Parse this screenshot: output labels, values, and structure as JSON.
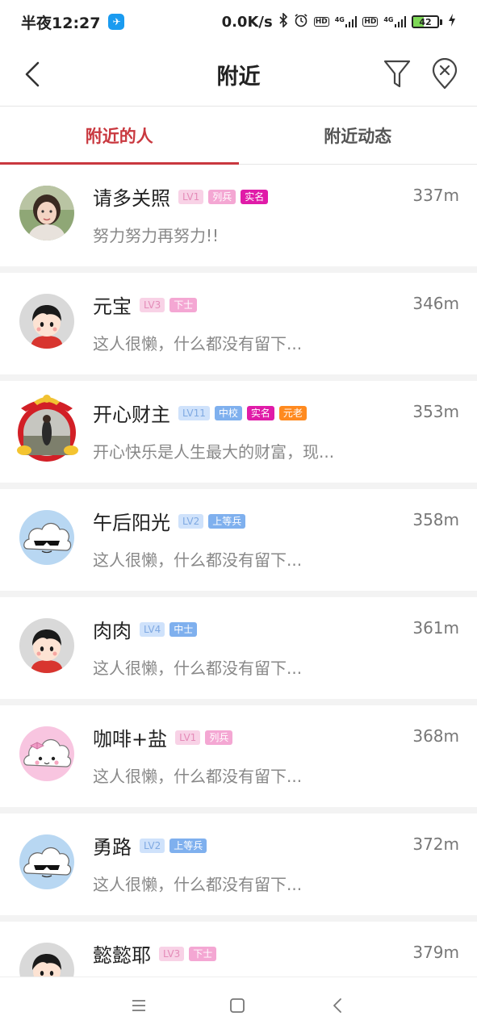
{
  "status_bar": {
    "time": "半夜12:27",
    "speed": "0.0K/s",
    "hd1": "HD",
    "hd2": "HD",
    "net1": "4G",
    "net2": "4G",
    "battery_level": "42"
  },
  "header": {
    "title": "附近"
  },
  "tabs": [
    {
      "label": "附近的人",
      "active": true
    },
    {
      "label": "附近动态",
      "active": false
    }
  ],
  "users": [
    {
      "name": "请多关照",
      "level": "LV1",
      "rank": "列兵",
      "real": "实名",
      "elder": "",
      "motto": "努力努力再努力!!",
      "distance": "337m",
      "lv_color": "pink",
      "rank_color": "pink",
      "avatar": "photo-woman"
    },
    {
      "name": "元宝",
      "level": "LV3",
      "rank": "下士",
      "real": "",
      "elder": "",
      "motto": "这人很懒，什么都没有留下...",
      "distance": "346m",
      "lv_color": "pink",
      "rank_color": "pink",
      "avatar": "cartoon-boy"
    },
    {
      "name": "开心财主",
      "level": "LV11",
      "rank": "中校",
      "real": "实名",
      "elder": "元老",
      "motto": "开心快乐是人生最大的财富，现...",
      "distance": "353m",
      "lv_color": "blue",
      "rank_color": "blue",
      "avatar": "fortune-frame"
    },
    {
      "name": "午后阳光",
      "level": "LV2",
      "rank": "上等兵",
      "real": "",
      "elder": "",
      "motto": "这人很懒，什么都没有留下...",
      "distance": "358m",
      "lv_color": "blue",
      "rank_color": "blue",
      "avatar": "cloud-sunglasses"
    },
    {
      "name": "肉肉",
      "level": "LV4",
      "rank": "中士",
      "real": "",
      "elder": "",
      "motto": "这人很懒，什么都没有留下...",
      "distance": "361m",
      "lv_color": "blue",
      "rank_color": "blue",
      "avatar": "cartoon-boy"
    },
    {
      "name": "咖啡+盐",
      "level": "LV1",
      "rank": "列兵",
      "real": "",
      "elder": "",
      "motto": "这人很懒，什么都没有留下...",
      "distance": "368m",
      "lv_color": "pink",
      "rank_color": "pink",
      "avatar": "cloud-bow"
    },
    {
      "name": "勇路",
      "level": "LV2",
      "rank": "上等兵",
      "real": "",
      "elder": "",
      "motto": "这人很懒，什么都没有留下...",
      "distance": "372m",
      "lv_color": "blue",
      "rank_color": "blue",
      "avatar": "cloud-sunglasses"
    },
    {
      "name": "懿懿耶",
      "level": "LV3",
      "rank": "下士",
      "real": "",
      "elder": "",
      "motto": "",
      "distance": "379m",
      "lv_color": "pink",
      "rank_color": "pink",
      "avatar": "cartoon-boy"
    }
  ],
  "icons": {
    "back": "chevron-left-icon",
    "filter": "funnel-icon",
    "location_off": "location-off-icon",
    "nav_menu": "menu-icon",
    "nav_home": "square-icon",
    "nav_back": "triangle-back-icon"
  }
}
